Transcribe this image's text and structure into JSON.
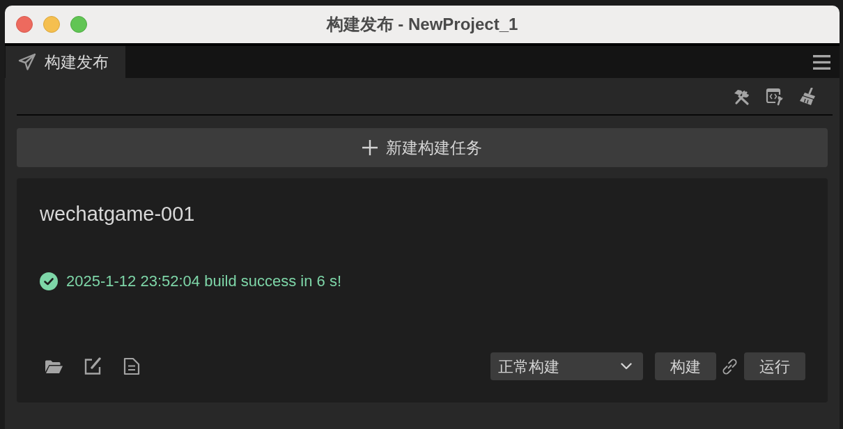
{
  "window": {
    "title": "构建发布 - NewProject_1"
  },
  "tabs": [
    {
      "label": "构建发布",
      "selected": true
    }
  ],
  "new_task_button": {
    "label": "新建构建任务"
  },
  "build_tasks": [
    {
      "name": "wechatgame-001",
      "status": {
        "kind": "success",
        "message": "2025-1-12 23:52:04 build success in 6 s!"
      },
      "build_mode": "正常构建",
      "actions": [
        "构建",
        "运行"
      ]
    }
  ]
}
